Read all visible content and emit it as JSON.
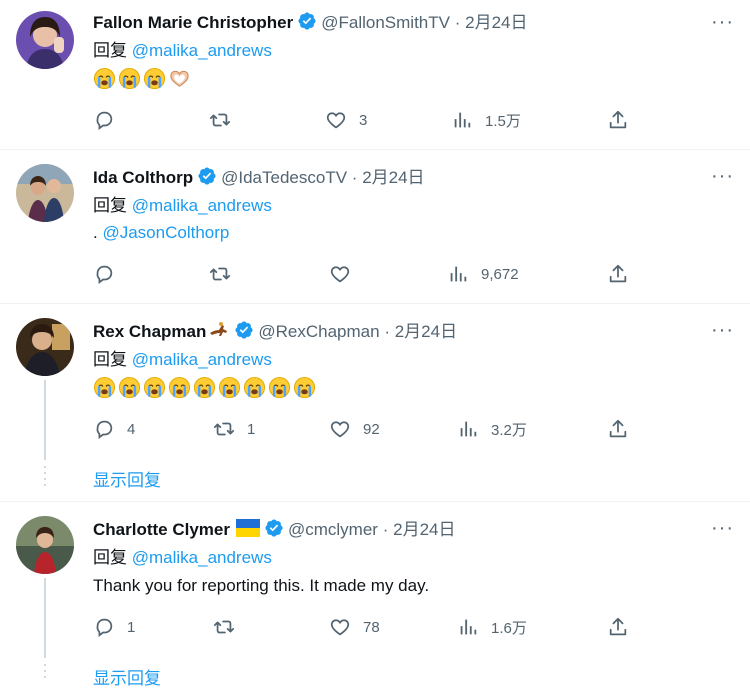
{
  "tweets": [
    {
      "name": "Fallon Marie Christopher",
      "handle": "@FallonSmithTV",
      "sep": "·",
      "date": "2月24日",
      "reply_label": "回复",
      "reply_to": "@malika_andrews",
      "replies": "",
      "retweets": "",
      "likes": "3",
      "views": "1.5万"
    },
    {
      "name": "Ida Colthorp",
      "handle": "@IdaTedescoTV",
      "sep": "·",
      "date": "2月24日",
      "reply_label": "回复",
      "reply_to": "@malika_andrews",
      "body_prefix": ".",
      "body_mention": "@JasonColthorp",
      "replies": "",
      "retweets": "",
      "likes": "",
      "views": "9,672"
    },
    {
      "name": "Rex Chapman",
      "handle": "@RexChapman",
      "sep": "·",
      "date": "2月24日",
      "reply_label": "回复",
      "reply_to": "@malika_andrews",
      "replies": "4",
      "retweets": "1",
      "likes": "92",
      "views": "3.2万",
      "show_replies": "显示回复"
    },
    {
      "name": "Charlotte Clymer",
      "handle": "@cmclymer",
      "sep": "·",
      "date": "2月24日",
      "reply_label": "回复",
      "reply_to": "@malika_andrews",
      "body_text": "Thank you for reporting this. It made my day.",
      "replies": "1",
      "retweets": "",
      "likes": "78",
      "views": "1.6万",
      "show_replies": "显示回复"
    }
  ],
  "more_icon": "···",
  "colors": {
    "accent": "#1d9bf0",
    "muted": "#536471",
    "verified": "#1d9bf0"
  }
}
